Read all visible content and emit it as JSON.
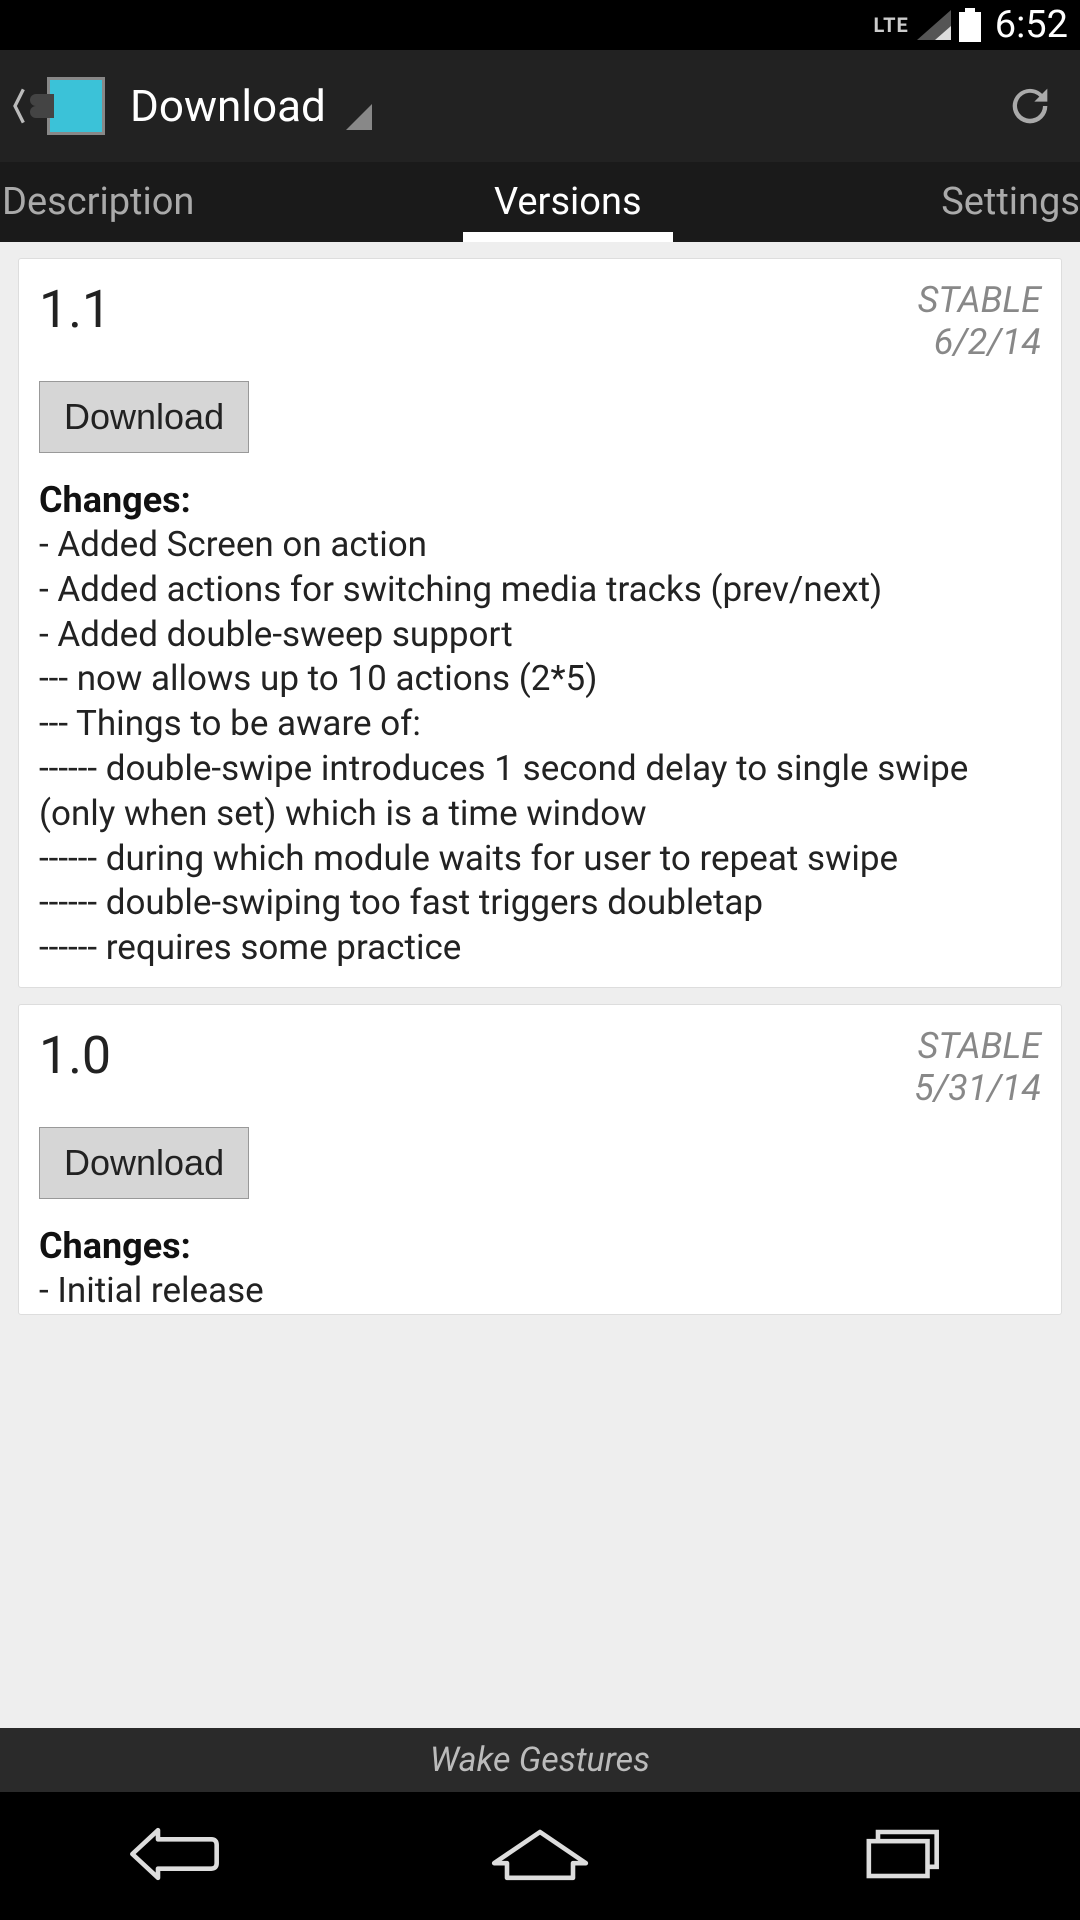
{
  "status_bar": {
    "network_type": "LTE",
    "clock": "6:52"
  },
  "action_bar": {
    "title": "Download"
  },
  "tabs": {
    "items": [
      {
        "label": "Description"
      },
      {
        "label": "Versions"
      },
      {
        "label": "Settings"
      }
    ],
    "active_index": 1
  },
  "versions": [
    {
      "number": "1.1",
      "status": "STABLE",
      "date": "6/2/14",
      "download_label": "Download",
      "changes_heading": "Changes:",
      "changes_body": "- Added Screen on action\n- Added actions for switching media tracks (prev/next)\n- Added double-sweep support\n--- now allows up to 10 actions (2*5)\n--- Things to be aware of:\n------ double-swipe introduces 1 second delay to single swipe (only when set) which is a time window\n------ during which module waits for user to repeat swipe\n------ double-swiping too fast triggers doubletap\n------ requires some practice"
    },
    {
      "number": "1.0",
      "status": "STABLE",
      "date": "5/31/14",
      "download_label": "Download",
      "changes_heading": "Changes:",
      "changes_body": "- Initial release"
    }
  ],
  "footer": {
    "module_name": "Wake Gestures"
  }
}
